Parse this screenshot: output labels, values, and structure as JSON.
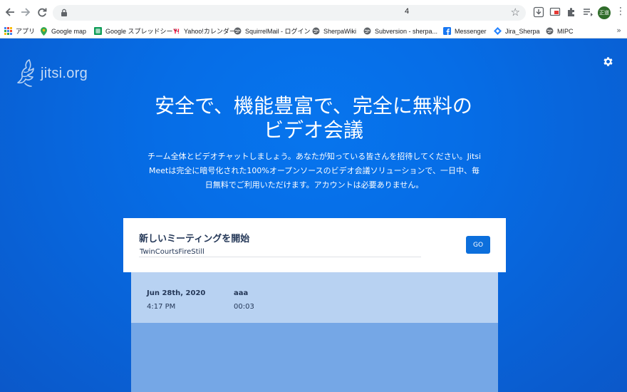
{
  "browser": {
    "url_text": "",
    "url_suffix": "4",
    "profile_label": "正道",
    "bookmarks": [
      {
        "label": "アプリ",
        "icon": "apps-grid-icon"
      },
      {
        "label": "Google map",
        "icon": "google-maps-icon"
      },
      {
        "label": "Google スプレッドシート",
        "icon": "google-sheets-icon"
      },
      {
        "label": "Yahoo!カレンダー",
        "icon": "yahoo-icon"
      },
      {
        "label": "SquirrelMail - ログイン",
        "icon": "globe-icon"
      },
      {
        "label": "SherpaWiki",
        "icon": "globe-icon"
      },
      {
        "label": "Subversion - sherpa...",
        "icon": "globe-icon"
      },
      {
        "label": "Messenger",
        "icon": "facebook-icon"
      },
      {
        "label": "Jira_Sherpa",
        "icon": "jira-icon"
      },
      {
        "label": "MIPC",
        "icon": "globe-icon"
      }
    ],
    "more_label": "»"
  },
  "page": {
    "logo_text": "jitsi.org",
    "headline_line1": "安全で、機能豊富で、完全に無料の",
    "headline_line2": "ビデオ会議",
    "subtext": "チーム全体とビデオチャットしましょう。あなたが知っている皆さんを招待してください。Jitsi Meetは完全に暗号化された100%オープンソースのビデオ会議ソリューションで、一日中、毎日無料でご利用いただけます。アカウントは必要ありません。",
    "start_title": "新しいミーティングを開始",
    "room_name": "TwinCourtsFireStill",
    "go_label": "GO",
    "recent": [
      {
        "date": "Jun 28th, 2020",
        "time": "4:17 PM",
        "name": "aaa",
        "duration": "00:03"
      }
    ]
  },
  "colors": {
    "brand_blue": "#0a62d8",
    "go_button": "#0c6fdc",
    "recent_item_bg": "#b8d2f2",
    "recent_list_bg": "#75a7e6"
  }
}
